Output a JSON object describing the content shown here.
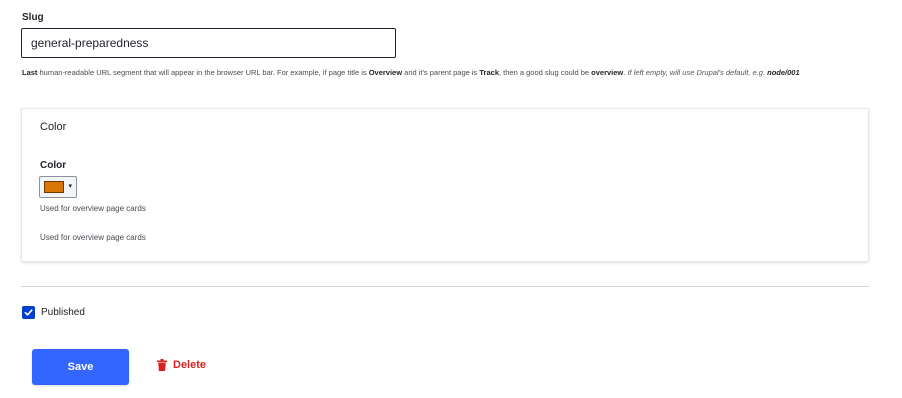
{
  "slug": {
    "label": "Slug",
    "value": "general-preparedness",
    "description": {
      "p1": "Last",
      "p2": " human-readable URL segment that will appear in the browser URL bar. For example, if page title is ",
      "p3": "Overview",
      "p4": " and it's parent page is ",
      "p5": "Track",
      "p6": ", then a good slug could be ",
      "p7": "overview",
      "p8": ". ",
      "p9": "If left empty, will use Drupal's default, e.g. ",
      "p10": "node/001"
    }
  },
  "color_section": {
    "title": "Color",
    "field_label": "Color",
    "value": "#d97706",
    "caret": "▾",
    "description_1": "Used for overview page cards",
    "description_2": "Used for overview page cards"
  },
  "published": {
    "label": "Published",
    "checked": true,
    "checkbox_color": "#003ecc"
  },
  "actions": {
    "save_label": "Save",
    "save_color": "#3366ff",
    "delete_label": "Delete",
    "delete_color": "#d72222",
    "delete_icon": "trash-icon"
  }
}
